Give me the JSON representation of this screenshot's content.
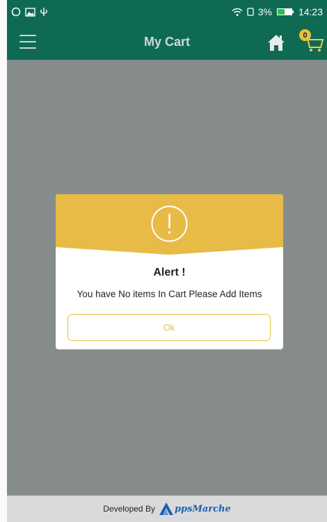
{
  "status_bar": {
    "battery": "3%",
    "time": "14:23",
    "icons": [
      "whatsapp-icon",
      "gallery-icon",
      "usb-icon",
      "wifi-icon",
      "sim-icon",
      "battery-icon"
    ]
  },
  "app_bar": {
    "title": "My Cart",
    "cart_count": "0",
    "icons": [
      "menu-icon",
      "home-icon",
      "cart-icon"
    ]
  },
  "dialog": {
    "title": "Alert !",
    "message": "You have No items In Cart Please Add Items",
    "ok_label": "Ok",
    "icon": "exclamation-circle-icon"
  },
  "footer": {
    "developed_by": "Developed By",
    "brand_initial": "A",
    "brand_rest": "ppsMarche"
  },
  "colors": {
    "primary": "#0f6a54",
    "accent": "#e6c23d",
    "dialog_header": "#e7bb45",
    "overlay": "#858c8b"
  }
}
